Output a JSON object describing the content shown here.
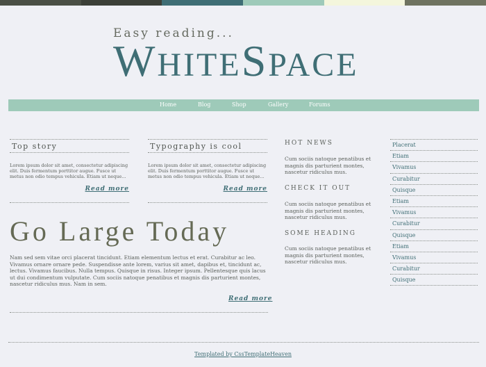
{
  "colors": {
    "stripe": [
      "#4a4f45",
      "#3c4038",
      "#3f6e75",
      "#9ecab9",
      "#f4f6dc",
      "#6f7360"
    ],
    "accent": "#3f6e75",
    "nav_bg": "#9ecab9"
  },
  "header": {
    "tagline": "Easy reading...",
    "logo_w": "W",
    "logo_hite": "HITE",
    "logo_s": "S",
    "logo_pace": "PACE"
  },
  "nav": {
    "items": [
      {
        "label": "Home"
      },
      {
        "label": "Blog"
      },
      {
        "label": "Shop"
      },
      {
        "label": "Gallery"
      },
      {
        "label": "Forums"
      }
    ]
  },
  "boxes": [
    {
      "title": "Top story",
      "body": "Lorem ipsum dolor sit amet, consectetur adipiscing elit. Duis fermentum porttitor augue. Fusce ut metus non odio tempus vehicula. Etiam ut neque...",
      "read_more": "Read more"
    },
    {
      "title": "Typography is cool",
      "body": "Lorem ipsum dolor sit amet, consectetur adipiscing elit. Duis fermentum porttitor augue. Fusce ut metus non odio tempus vehicula. Etiam ut neque...",
      "read_more": "Read more"
    }
  ],
  "main": {
    "title": "Go Large Today",
    "body": "Nam sed sem vitae orci placerat tincidunt. Etiam elementum lectus et erat. Curabitur ac leo. Vivamus ornare ornare pede. Suspendisse ante lorem, varius sit amet, dapibus et, tincidunt ac, lectus. Vivamus faucibus. Nulla tempus. Quisque in risus. Integer ipsum. Pellentesque quis lacus ut dui condimentum vulputate. Cum sociis natoque penatibus et magnis dis parturient montes, nascetur ridiculus mus. Nam in sem.",
    "read_more": "Read more"
  },
  "sidebar": {
    "sections": [
      {
        "heading": "HOT NEWS",
        "body": "Cum sociis natoque penatibus et magnis dis parturient montes, nascetur ridiculus mus."
      },
      {
        "heading": "CHECK IT OUT",
        "body": "Cum sociis natoque penatibus et magnis dis parturient montes, nascetur ridiculus mus."
      },
      {
        "heading": "SOME HEADING",
        "body": "Cum sociis natoque penatibus et magnis dis parturient montes, nascetur ridiculus mus."
      }
    ]
  },
  "links": [
    "Placerat",
    "Etiam",
    "Vivamus",
    "Curabitur",
    "Quisque",
    "Etiam",
    "Vivamus",
    "Curabitur",
    "Quisque",
    "Etiam",
    "Vivamus",
    "Curabitur",
    "Quisque"
  ],
  "footer": {
    "credit": "Templated by CssTemplateHeaven"
  }
}
